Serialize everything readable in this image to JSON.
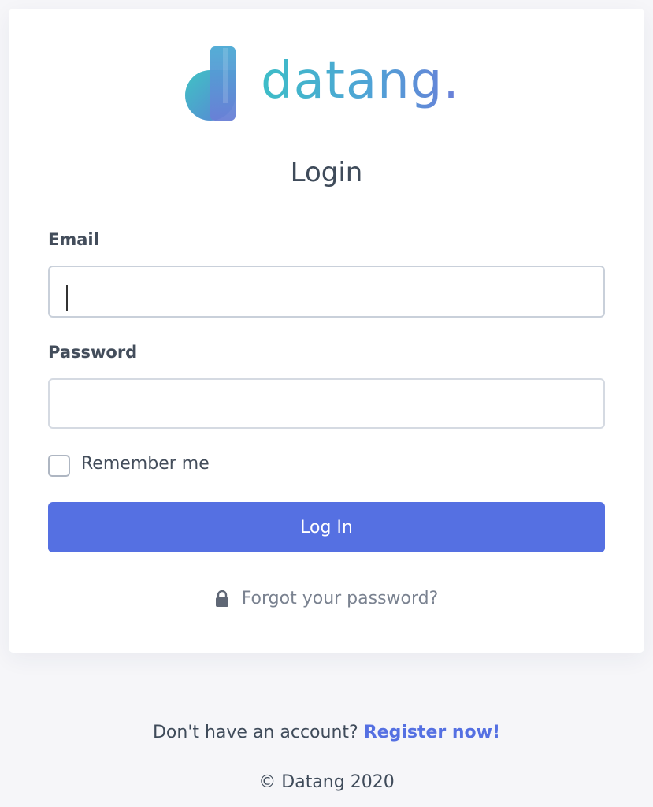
{
  "brand": {
    "name": "datang.",
    "logo_icon": "d-logo-mark",
    "gradient_start": "#3dbdc7",
    "gradient_end": "#6a7ed8"
  },
  "form": {
    "title": "Login",
    "email_label": "Email",
    "email_value": "",
    "password_label": "Password",
    "password_value": "",
    "remember_label": "Remember me",
    "remember_checked": false,
    "submit_label": "Log In",
    "forgot_label": "Forgot your password?",
    "forgot_icon": "lock-icon"
  },
  "footer": {
    "register_prompt": "Don't have an account?",
    "register_link": "Register now!",
    "copyright": "© Datang 2020"
  },
  "colors": {
    "primary": "#5570e2",
    "background": "#f6f6f9",
    "card": "#ffffff",
    "text": "#3f4b5a",
    "muted": "#7a8290"
  }
}
